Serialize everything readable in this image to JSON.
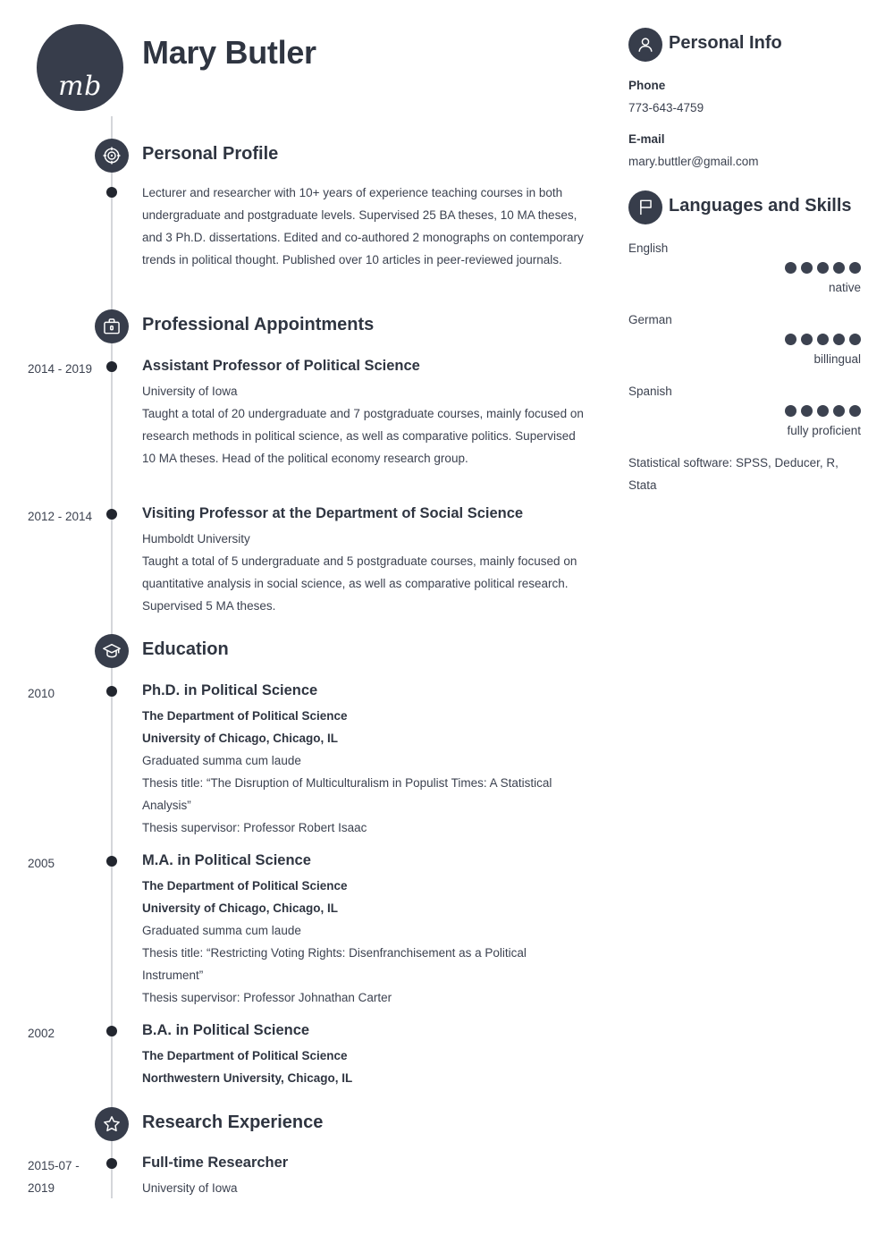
{
  "header": {
    "initials": "mb",
    "name": "Mary Butler"
  },
  "sections": {
    "profile": {
      "title": "Personal Profile",
      "icon": "target-icon",
      "text": "Lecturer and researcher with 10+ years of experience teaching courses in both undergraduate and postgraduate levels. Supervised 25 BA theses, 10 MA theses, and 3 Ph.D. dissertations. Edited and co-authored 2 monographs on contemporary trends in political thought. Published over 10 articles in peer-reviewed journals."
    },
    "appointments": {
      "title": "Professional Appointments",
      "icon": "briefcase-icon",
      "entries": [
        {
          "date": "2014 - 2019",
          "title": "Assistant Professor of Political Science",
          "org": "University of Iowa",
          "text": "Taught a total of 20 undergraduate and 7 postgraduate courses, mainly focused on research methods in political science, as well as comparative politics. Supervised 10 MA theses. Head of the political economy research group."
        },
        {
          "date": "2012 - 2014",
          "title": "Visiting Professor at the Department of Social Science",
          "org": "Humboldt University",
          "text": "Taught a total of 5 undergraduate and 5 postgraduate courses, mainly focused on quantitative analysis in social science, as well as comparative political research. Supervised 5 MA theses."
        }
      ]
    },
    "education": {
      "title": "Education",
      "icon": "graduation-cap-icon",
      "entries": [
        {
          "date": "2010",
          "title": "Ph.D. in Political Science",
          "department": "The Department of Political Science",
          "university": "University of Chicago, Chicago, IL",
          "honors": "Graduated summa cum laude",
          "thesis": "Thesis title: “The Disruption of Multiculturalism in Populist Times: A Statistical Analysis”",
          "supervisor": "Thesis supervisor: Professor Robert Isaac"
        },
        {
          "date": "2005",
          "title": "M.A. in Political Science",
          "department": "The Department of Political Science",
          "university": "University of Chicago, Chicago, IL",
          "honors": "Graduated summa cum laude",
          "thesis": "Thesis title: “Restricting Voting Rights: Disenfranchisement as a Political Instrument”",
          "supervisor": "Thesis supervisor: Professor Johnathan Carter"
        },
        {
          "date": "2002",
          "title": "B.A. in Political Science",
          "department": "The Department of Political Science",
          "university": "Northwestern University, Chicago, IL",
          "honors": "",
          "thesis": "",
          "supervisor": ""
        }
      ]
    },
    "research": {
      "title": "Research Experience",
      "icon": "star-icon",
      "entries": [
        {
          "date": "2015-07 - 2019",
          "title": "Full-time Researcher",
          "org": "University of Iowa"
        }
      ]
    }
  },
  "sidebar": {
    "personal_info": {
      "title": "Personal Info",
      "icon": "person-icon",
      "phone_label": "Phone",
      "phone_value": "773-643-4759",
      "email_label": "E-mail",
      "email_value": "mary.buttler@gmail.com"
    },
    "languages": {
      "title": "Languages and Skills",
      "icon": "flag-icon",
      "max_dots": 5,
      "items": [
        {
          "name": "English",
          "rating": 5,
          "level": "native"
        },
        {
          "name": "German",
          "rating": 5,
          "level": "billingual"
        },
        {
          "name": "Spanish",
          "rating": 5,
          "level": "fully proficient"
        }
      ],
      "note": "Statistical software: SPSS, Deducer, R, Stata"
    }
  },
  "theme": {
    "dark": "#373d4b",
    "text": "#3c4250",
    "rail": "#d4d6da"
  }
}
